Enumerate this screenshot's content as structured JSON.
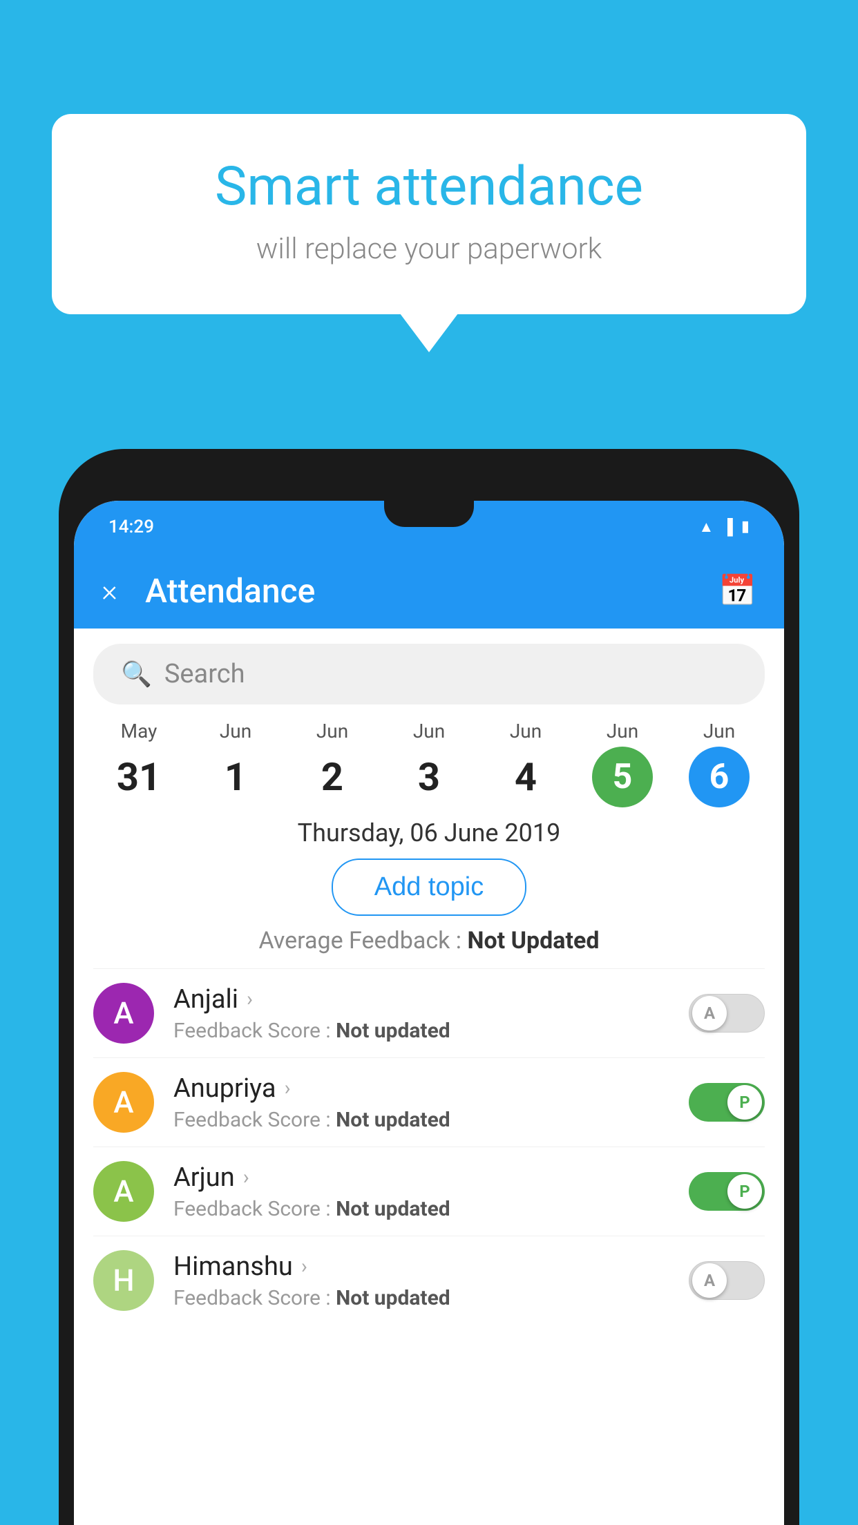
{
  "background_color": "#29b6e8",
  "bubble": {
    "title": "Smart attendance",
    "subtitle": "will replace your paperwork"
  },
  "status_bar": {
    "time": "14:29",
    "icons": [
      "wifi",
      "signal",
      "battery"
    ]
  },
  "header": {
    "title": "Attendance",
    "close_label": "×",
    "calendar_icon": "📅"
  },
  "search": {
    "placeholder": "Search"
  },
  "calendar": {
    "dates": [
      {
        "month": "May",
        "day": "31",
        "style": "normal"
      },
      {
        "month": "Jun",
        "day": "1",
        "style": "normal"
      },
      {
        "month": "Jun",
        "day": "2",
        "style": "normal"
      },
      {
        "month": "Jun",
        "day": "3",
        "style": "normal"
      },
      {
        "month": "Jun",
        "day": "4",
        "style": "normal"
      },
      {
        "month": "Jun",
        "day": "5",
        "style": "green"
      },
      {
        "month": "Jun",
        "day": "6",
        "style": "blue"
      }
    ],
    "selected_date_label": "Thursday, 06 June 2019"
  },
  "add_topic": {
    "label": "Add topic"
  },
  "avg_feedback": {
    "label": "Average Feedback :",
    "value": "Not Updated"
  },
  "students": [
    {
      "name": "Anjali",
      "avatar_letter": "A",
      "avatar_color": "#9c27b0",
      "feedback_label": "Feedback Score :",
      "feedback_value": "Not updated",
      "toggle_state": "off",
      "toggle_letter": "A"
    },
    {
      "name": "Anupriya",
      "avatar_letter": "A",
      "avatar_color": "#f9a825",
      "feedback_label": "Feedback Score :",
      "feedback_value": "Not updated",
      "toggle_state": "on",
      "toggle_letter": "P"
    },
    {
      "name": "Arjun",
      "avatar_letter": "A",
      "avatar_color": "#8bc34a",
      "feedback_label": "Feedback Score :",
      "feedback_value": "Not updated",
      "toggle_state": "on",
      "toggle_letter": "P"
    },
    {
      "name": "Himanshu",
      "avatar_letter": "H",
      "avatar_color": "#aed581",
      "feedback_label": "Feedback Score :",
      "feedback_value": "Not updated",
      "toggle_state": "off",
      "toggle_letter": "A"
    }
  ]
}
